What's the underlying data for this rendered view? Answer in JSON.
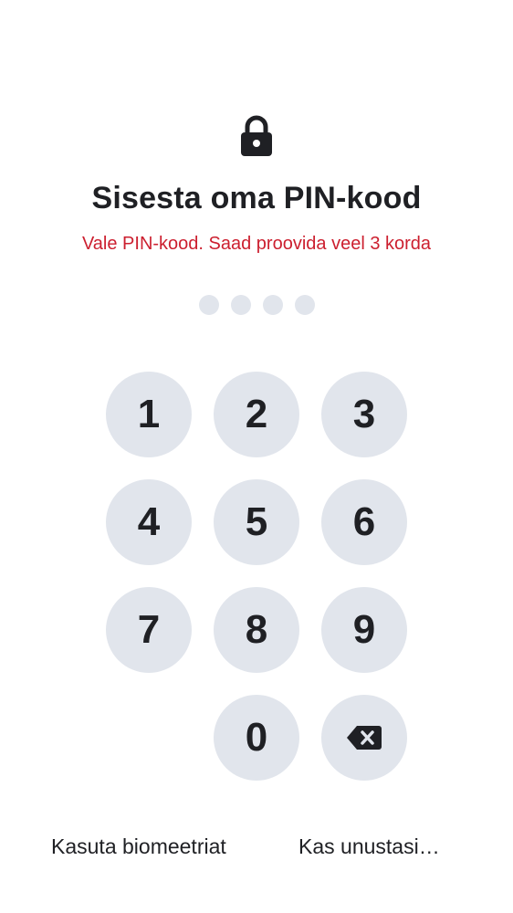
{
  "header": {
    "icon": "lock-icon",
    "title": "Sisesta oma PIN-kood",
    "error_message": "Vale PIN-kood. Saad proovida veel 3 korda"
  },
  "pin_indicator": {
    "length": 4,
    "filled": 0
  },
  "keypad": {
    "keys": [
      "1",
      "2",
      "3",
      "4",
      "5",
      "6",
      "7",
      "8",
      "9",
      "0"
    ],
    "backspace_icon": "backspace-icon"
  },
  "footer": {
    "biometrics_label": "Kasuta biomeetriat",
    "forgot_label": "Kas unustasi…"
  },
  "colors": {
    "key_background": "#e1e5ec",
    "text": "#1f2024",
    "error": "#cc1f2f"
  }
}
